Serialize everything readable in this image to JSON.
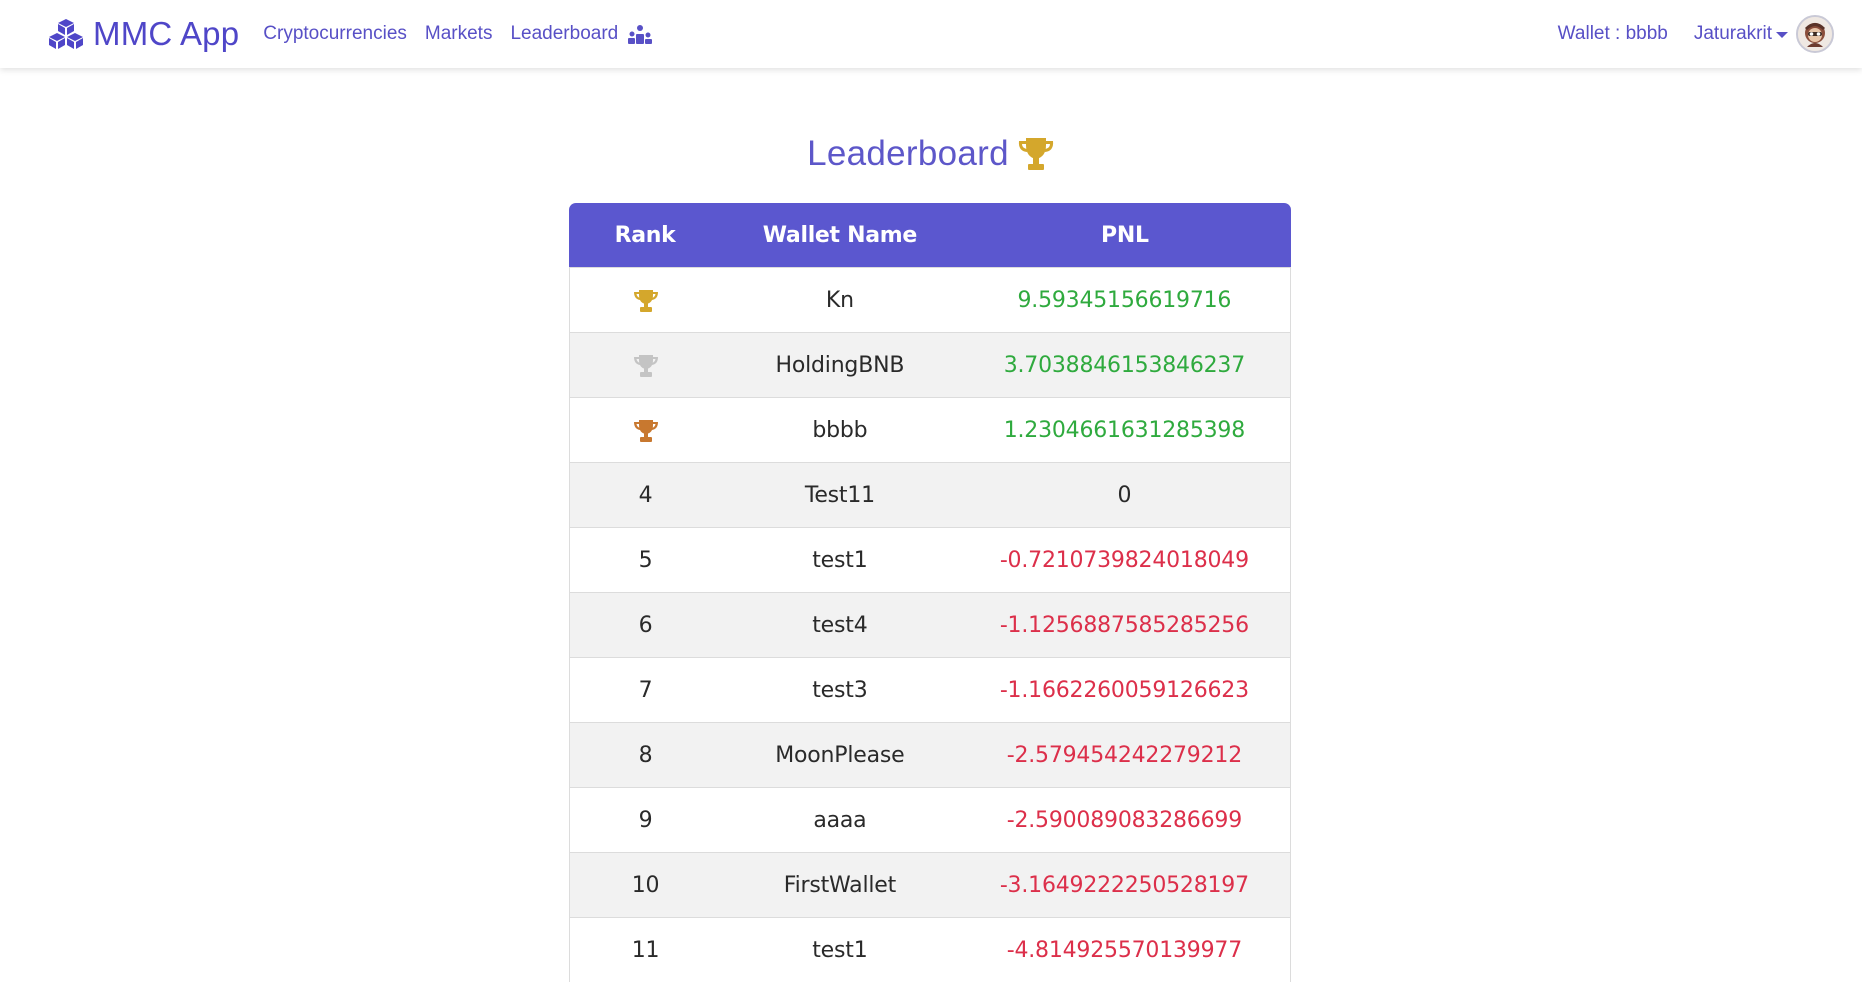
{
  "navbar": {
    "brand": "MMC App",
    "links": [
      {
        "label": "Cryptocurrencies"
      },
      {
        "label": "Markets"
      },
      {
        "label": "Leaderboard"
      }
    ],
    "wallet": "Wallet : bbbb",
    "user": "Jaturakrit"
  },
  "page": {
    "title": "Leaderboard"
  },
  "table": {
    "headers": [
      "Rank",
      "Wallet Name",
      "PNL"
    ],
    "rows": [
      {
        "rank": "",
        "trophy": "gold-trophy-icon",
        "name": "Kn",
        "pnl": "9.59345156619716",
        "sign": "pos"
      },
      {
        "rank": "",
        "trophy": "silver-trophy-icon",
        "name": "HoldingBNB",
        "pnl": "3.7038846153846237",
        "sign": "pos"
      },
      {
        "rank": "",
        "trophy": "bronze-trophy-icon",
        "name": "bbbb",
        "pnl": "1.2304661631285398",
        "sign": "pos"
      },
      {
        "rank": "4",
        "name": "Test11",
        "pnl": "0",
        "sign": "zero"
      },
      {
        "rank": "5",
        "name": "test1",
        "pnl": "-0.7210739824018049",
        "sign": "neg"
      },
      {
        "rank": "6",
        "name": "test4",
        "pnl": "-1.1256887585285256",
        "sign": "neg"
      },
      {
        "rank": "7",
        "name": "test3",
        "pnl": "-1.1662260059126623",
        "sign": "neg"
      },
      {
        "rank": "8",
        "name": "MoonPlease",
        "pnl": "-2.579454242279212",
        "sign": "neg"
      },
      {
        "rank": "9",
        "name": "aaaa",
        "pnl": "-2.590089083286699",
        "sign": "neg"
      },
      {
        "rank": "10",
        "name": "FirstWallet",
        "pnl": "-3.1649222250528197",
        "sign": "neg"
      },
      {
        "rank": "11",
        "name": "test1",
        "pnl": "-4.814925570139977",
        "sign": "neg"
      }
    ]
  },
  "colors": {
    "brand": "#4f46c8",
    "header": "#5b57cf",
    "positive": "#2faa3e",
    "negative": "#dc2f4a",
    "gold": "#d4a72c",
    "silver": "#c4c4c4",
    "bronze": "#c8782f"
  }
}
